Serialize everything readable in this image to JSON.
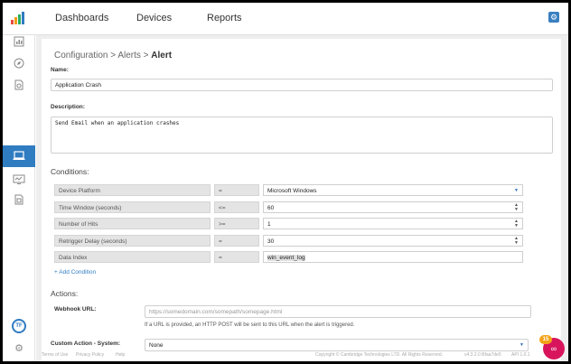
{
  "nav": {
    "items": [
      {
        "label": "Dashboards"
      },
      {
        "label": "Devices"
      },
      {
        "label": "Reports"
      }
    ],
    "settings_icon": "settings-icon"
  },
  "sidebar": {
    "icons": [
      "chart-icon",
      "compass-icon",
      "document-chart-icon",
      "laptop-icon",
      "monitor-icon",
      "document-icon"
    ],
    "active": "laptop-icon",
    "avatar_initials": "TF",
    "settings_icon": "gear-icon"
  },
  "breadcrumb": {
    "part1": "Configuration > Alerts > ",
    "current": "Alert"
  },
  "form": {
    "name_label": "Name:",
    "name_value": "Application Crash",
    "description_label": "Description:",
    "description_value": "Send Email when an application crashes",
    "conditions_label": "Conditions:",
    "conditions": [
      {
        "field": "Device Platform",
        "op": "=",
        "value": "Microsoft Windows",
        "control": "select"
      },
      {
        "field": "Time Window (seconds)",
        "op": "<=",
        "value": "60",
        "control": "number"
      },
      {
        "field": "Number of Hits",
        "op": ">=",
        "value": "1",
        "control": "number"
      },
      {
        "field": "Retrigger Delay (seconds)",
        "op": "=",
        "value": "30",
        "control": "number"
      },
      {
        "field": "Data Index",
        "op": "=",
        "value": "win_event_log",
        "control": "text"
      }
    ],
    "add_condition": "+ Add Condition",
    "actions_label": "Actions:",
    "webhook_label": "Webhook URL:",
    "webhook_placeholder": "https://somedomain.com/somepath/somepage.html",
    "webhook_hint": "If a URL is provided, an HTTP POST will be sent to this URL when the alert is triggered.",
    "custom_action_label": "Custom Action - System:",
    "custom_action_value": "None"
  },
  "footer": {
    "links": [
      "Terms of Use",
      "Privacy Policy",
      "Help"
    ],
    "copyright": "Copyright © Cambridge Technologies LTD. All Rights Reserved.",
    "version": "v4.3.2.0 Bfaa7de0",
    "api": "API 1.0.1"
  },
  "notifications": {
    "badge_count": "15",
    "bubble_icon": "chat-icon"
  },
  "colors": {
    "accent": "#2f7cc1",
    "badge": "#f4a318",
    "help": "#d8155c"
  }
}
